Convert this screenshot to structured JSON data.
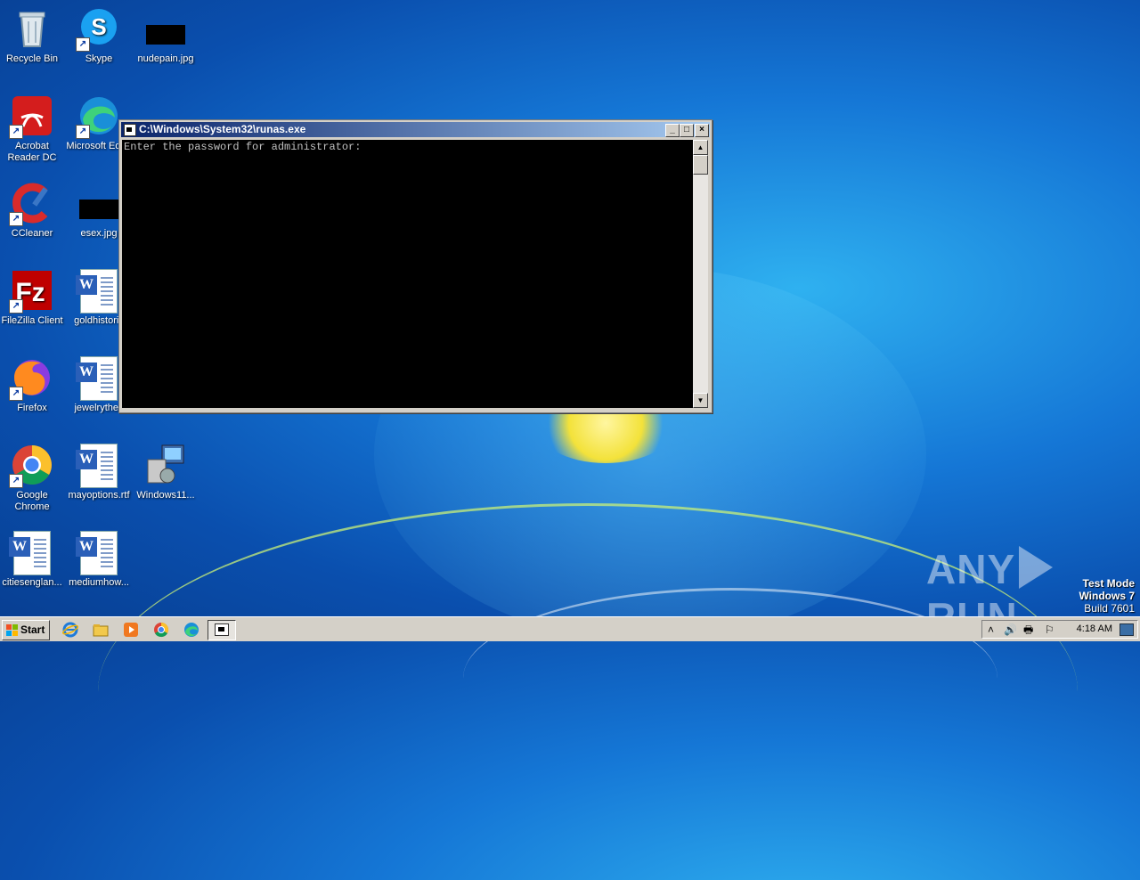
{
  "desktop": {
    "icons": [
      {
        "label": "Recycle Bin",
        "icon": "recycle-bin-icon"
      },
      {
        "label": "Skype",
        "icon": "skype-icon"
      },
      {
        "label": "nudepain.jpg",
        "icon": "image-file-icon"
      },
      {
        "label": "Acrobat Reader DC",
        "icon": "acrobat-icon"
      },
      {
        "label": "Microsoft Edge",
        "icon": "edge-icon"
      },
      {
        "label": "CCleaner",
        "icon": "ccleaner-icon"
      },
      {
        "label": "esex.jpg",
        "icon": "image-file-icon"
      },
      {
        "label": "FileZilla Client",
        "icon": "filezilla-icon"
      },
      {
        "label": "goldhistoric",
        "icon": "word-doc-icon"
      },
      {
        "label": "Firefox",
        "icon": "firefox-icon"
      },
      {
        "label": "jewelrythes",
        "icon": "word-doc-icon"
      },
      {
        "label": "Google Chrome",
        "icon": "chrome-icon"
      },
      {
        "label": "mayoptions.rtf",
        "icon": "word-doc-icon"
      },
      {
        "label": "Windows11...",
        "icon": "installer-icon"
      },
      {
        "label": "citiesenglan...",
        "icon": "word-doc-icon"
      },
      {
        "label": "mediumhow...",
        "icon": "word-doc-icon"
      }
    ]
  },
  "window": {
    "title": "C:\\Windows\\System32\\runas.exe",
    "console_text": "Enter the password for administrator:",
    "buttons": {
      "minimize": "_",
      "maximize": "□",
      "close": "×"
    },
    "scroll_up": "▲",
    "scroll_down": "▼"
  },
  "watermark": {
    "brand_left": "ANY",
    "brand_right": "RUN",
    "line1": "Test Mode",
    "line2": "Windows 7",
    "line3": "Build 7601"
  },
  "taskbar": {
    "start_label": "Start",
    "clock": "4:18 AM",
    "tray_expand": "˄"
  },
  "colors": {
    "title_active": "#0a246a",
    "desktop": "#1577d6",
    "console_bg": "#000000"
  }
}
